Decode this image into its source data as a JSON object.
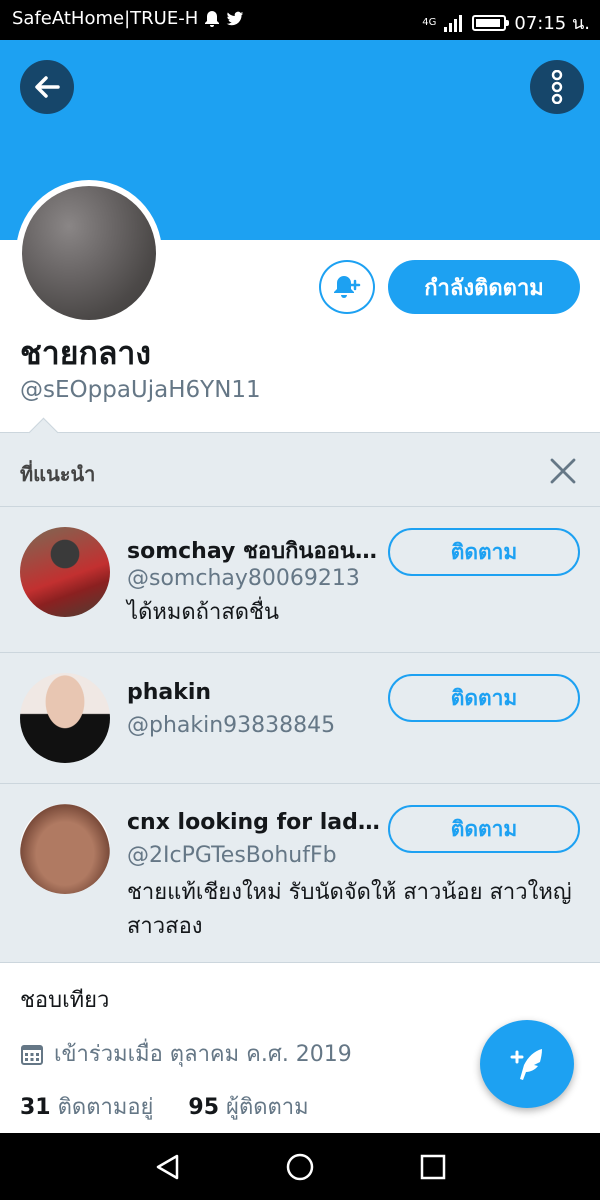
{
  "status_bar": {
    "carrier": "SafeAtHome|TRUE-H",
    "network": "4G",
    "time": "07:15 น."
  },
  "profile": {
    "name": "ชายกลาง",
    "handle": "@sEOppaUjaH6YN11",
    "following_button": "กำลังติดตาม",
    "bio": "ชอบเทียว",
    "joined": "เข้าร่วมเมื่อ ตุลาคม ค.ศ. 2019",
    "following_count": "31",
    "following_label": "ติดตามอยู่",
    "followers_count": "95",
    "followers_label": "ผู้ติดตาม"
  },
  "suggestions": {
    "title": "ที่แนะนำ",
    "follow_label": "ติดตาม",
    "items": [
      {
        "name": "somchay ชอบกินออน…",
        "handle": "@somchay80069213",
        "bio": "ได้หมดถ้าสดชื่น"
      },
      {
        "name": "phakin",
        "handle": "@phakin93838845",
        "bio": ""
      },
      {
        "name": "cnx looking for ladyboy",
        "handle": "@2IcPGTesBohufFb",
        "bio": "ชายแท้เชียงใหม่ รับนัดจัดให้ สาวน้อย สาวใหญ่ สาวสอง"
      }
    ]
  },
  "colors": {
    "brand": "#1da1f2",
    "muted": "#657786",
    "panel": "#e6ecf0"
  },
  "icons": [
    "back-arrow-icon",
    "more-vertical-icon",
    "bell-plus-icon",
    "close-icon",
    "calendar-icon",
    "compose-icon",
    "nav-back-icon",
    "nav-home-icon",
    "nav-recents-icon"
  ]
}
